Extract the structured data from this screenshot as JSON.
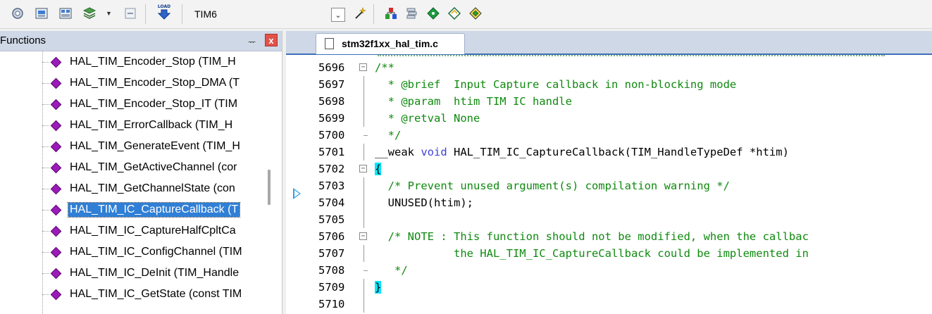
{
  "toolbar": {
    "target_label": "TIM6",
    "icons": [
      "settings-gear-icon",
      "build-target-icon",
      "batch-build-icon",
      "manage-components-icon",
      "translate-icon",
      "load-download-icon",
      "dropdown-icon",
      "magic-wand-icon",
      "pack-installer-icon",
      "layers-icon",
      "green-diamond-icon",
      "diamond-outline-icon",
      "diamond-grid-icon"
    ],
    "load_text": "LOAD"
  },
  "functions_panel": {
    "title": "Functions",
    "pin_glyph": "ᅲ",
    "close_glyph": "x",
    "items": [
      {
        "label": "HAL_TIM_Encoder_Stop (TIM_H",
        "selected": false
      },
      {
        "label": "HAL_TIM_Encoder_Stop_DMA (T",
        "selected": false
      },
      {
        "label": "HAL_TIM_Encoder_Stop_IT (TIM",
        "selected": false
      },
      {
        "label": "HAL_TIM_ErrorCallback (TIM_H",
        "selected": false
      },
      {
        "label": "HAL_TIM_GenerateEvent (TIM_H",
        "selected": false
      },
      {
        "label": "HAL_TIM_GetActiveChannel (cor",
        "selected": false
      },
      {
        "label": "HAL_TIM_GetChannelState (con",
        "selected": false
      },
      {
        "label": "HAL_TIM_IC_CaptureCallback (T",
        "selected": true
      },
      {
        "label": "HAL_TIM_IC_CaptureHalfCpltCa",
        "selected": false
      },
      {
        "label": "HAL_TIM_IC_ConfigChannel (TIM",
        "selected": false
      },
      {
        "label": "HAL_TIM_IC_DeInit (TIM_Handle",
        "selected": false
      },
      {
        "label": "HAL_TIM_IC_GetState (const TIM",
        "selected": false
      }
    ]
  },
  "editor": {
    "tab_label": "stm32f1xx_hal_tim.c",
    "lines": [
      {
        "num": "5696",
        "parts": [
          {
            "t": "/**",
            "c": "cmt"
          }
        ]
      },
      {
        "num": "5697",
        "parts": [
          {
            "t": "  * @brief  Input Capture callback in non-blocking mode",
            "c": "cmt"
          }
        ]
      },
      {
        "num": "5698",
        "parts": [
          {
            "t": "  * @param  htim TIM IC handle",
            "c": "cmt"
          }
        ]
      },
      {
        "num": "5699",
        "parts": [
          {
            "t": "  * @retval None",
            "c": "cmt"
          }
        ]
      },
      {
        "num": "5700",
        "parts": [
          {
            "t": "  */",
            "c": "cmt"
          }
        ]
      },
      {
        "num": "5701",
        "parts": [
          {
            "t": "__weak ",
            "c": ""
          },
          {
            "t": "void",
            "c": "kw"
          },
          {
            "t": " HAL_TIM_IC_CaptureCallback(TIM_HandleTypeDef *htim)",
            "c": ""
          }
        ]
      },
      {
        "num": "5702",
        "parts": [
          {
            "t": "{",
            "c": "brace"
          }
        ]
      },
      {
        "num": "5703",
        "parts": [
          {
            "t": "  /* Prevent unused argument(s) compilation warning */",
            "c": "cmt"
          }
        ]
      },
      {
        "num": "5704",
        "parts": [
          {
            "t": "  UNUSED(htim);",
            "c": ""
          }
        ]
      },
      {
        "num": "5705",
        "parts": []
      },
      {
        "num": "5706",
        "parts": [
          {
            "t": "  /* NOTE : This function should not be modified, when the callbac",
            "c": "cmt"
          }
        ]
      },
      {
        "num": "5707",
        "parts": [
          {
            "t": "            the HAL_TIM_IC_CaptureCallback could be implemented in",
            "c": "cmt"
          }
        ]
      },
      {
        "num": "5708",
        "parts": [
          {
            "t": "   */",
            "c": "cmt"
          }
        ]
      },
      {
        "num": "5709",
        "parts": [
          {
            "t": "}",
            "c": "brace"
          }
        ]
      },
      {
        "num": "5710",
        "parts": []
      }
    ]
  }
}
